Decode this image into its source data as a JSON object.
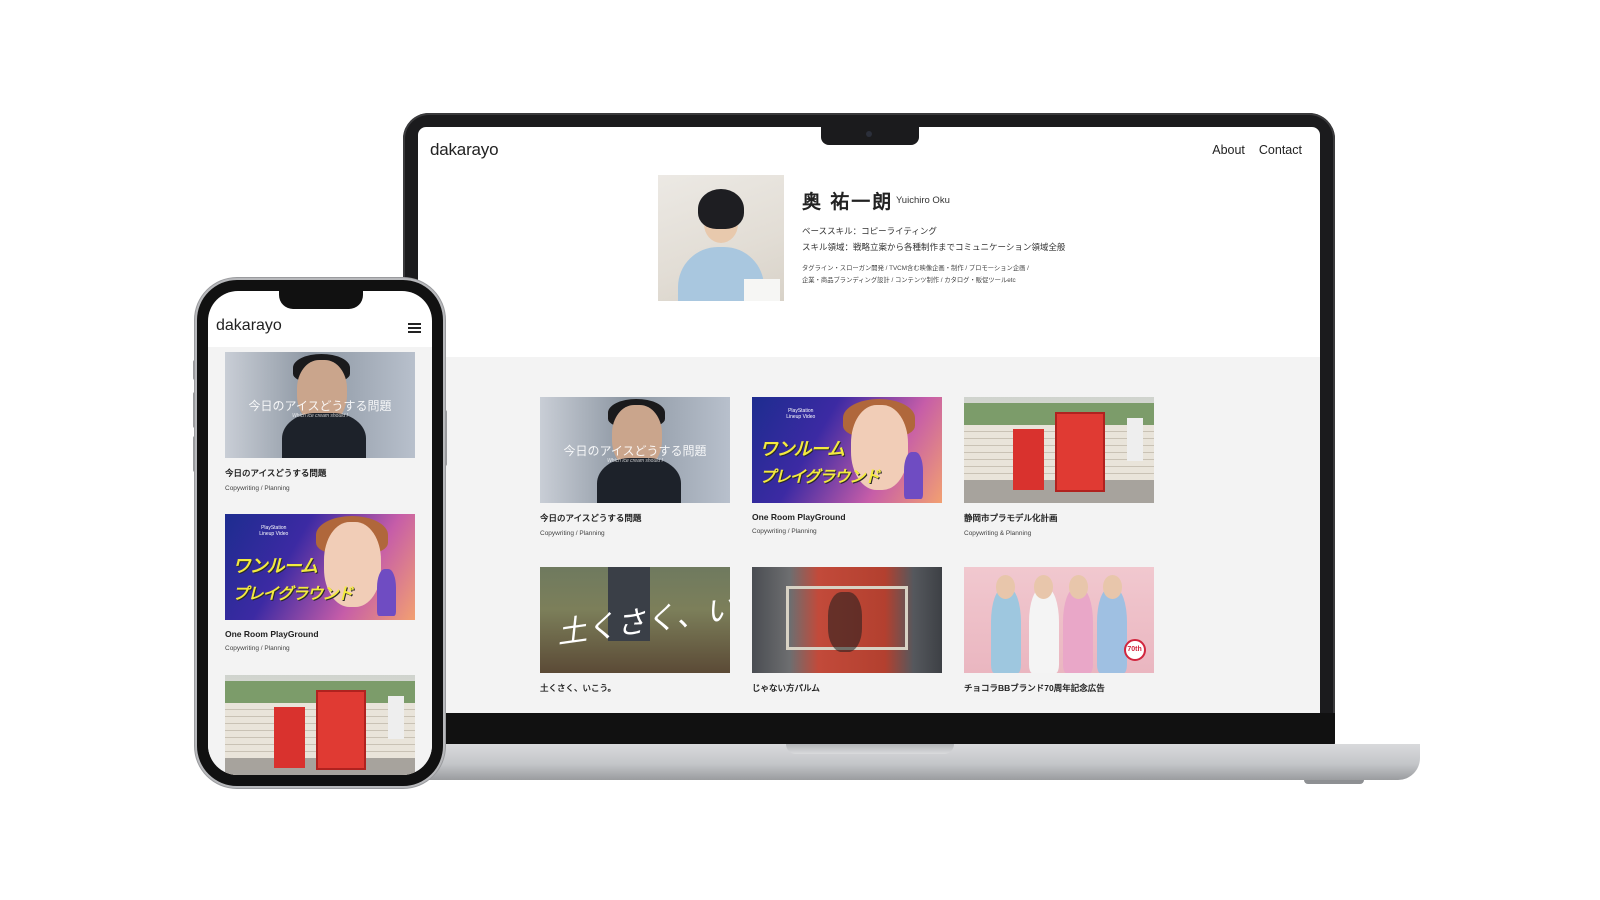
{
  "laptop": {
    "header": {
      "logo": "dakarayo",
      "nav": [
        {
          "label": "About"
        },
        {
          "label": "Contact"
        }
      ]
    },
    "profile": {
      "name_jp": "奥 祐一朗",
      "name_en": "Yuichiro Oku",
      "base_skill": "ベーススキル：コピーライティング",
      "skill_area": "スキル領域：戦略立案から各種制作までコミュニケーション領域全般",
      "details_line1": "タグライン・スローガン開発 / TVCM含む映像企画・制作 / プロモーション企画 /",
      "details_line2": "企業・商品ブランディング設計 / コンテンツ制作 / カタログ・販促ツールetc"
    },
    "works": [
      {
        "title": "今日のアイスどうする問題",
        "tags": "Copywriting / Planning",
        "thumb_caption": "今日のアイスどうする問題",
        "thumb_sub": "Which ice cream should I"
      },
      {
        "title": "One Room PlayGround",
        "tags": "Copywriting / Planning",
        "thumb_logo1": "ワンルーム",
        "thumb_logo2": "プレイグラウンド",
        "thumb_small": "PlayStation\nLineup Video"
      },
      {
        "title": "静岡市プラモデル化計画",
        "tags": "Copywriting & Planning"
      },
      {
        "title": "土くさく、いこう。",
        "tags": "",
        "thumb_lettering": "土くさく、いこう。"
      },
      {
        "title": "じゃない方パルム",
        "tags": ""
      },
      {
        "title": "チョコラBBブランド70周年記念広告",
        "tags": "",
        "thumb_badge": "70th"
      }
    ]
  },
  "phone": {
    "header": {
      "logo": "dakarayo",
      "menu_icon": "hamburger-menu-icon"
    },
    "works": [
      {
        "title": "今日のアイスどうする問題",
        "tags": "Copywriting / Planning",
        "thumb_caption": "今日のアイスどうする問題",
        "thumb_sub": "Which ice cream should I"
      },
      {
        "title": "One Room PlayGround",
        "tags": "Copywriting / Planning",
        "thumb_logo1": "ワンルーム",
        "thumb_logo2": "プレイグラウンド",
        "thumb_small": "PlayStation\nLineup Video"
      },
      {
        "title": "",
        "tags": ""
      }
    ]
  }
}
